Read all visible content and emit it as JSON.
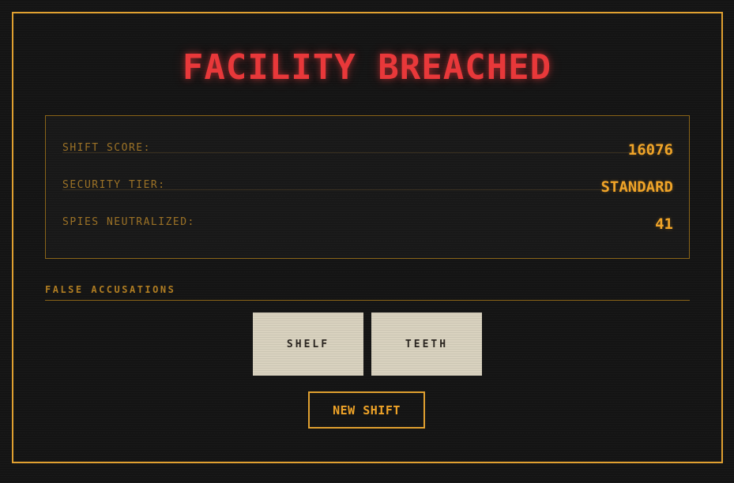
{
  "title": "FACILITY BREACHED",
  "stats": [
    {
      "label": "SHIFT SCORE:",
      "value": "16076"
    },
    {
      "label": "SECURITY TIER:",
      "value": "STANDARD"
    },
    {
      "label": "SPIES NEUTRALIZED:",
      "value": "41"
    }
  ],
  "false_accusations": {
    "label": "FALSE ACCUSATIONS",
    "cards": [
      "SHELF",
      "TEETH"
    ]
  },
  "new_shift_label": "NEW SHIFT",
  "colors": {
    "accent": "#e0a030",
    "title": "#e8383a",
    "background": "#141414",
    "card": "#d9d2bf"
  }
}
